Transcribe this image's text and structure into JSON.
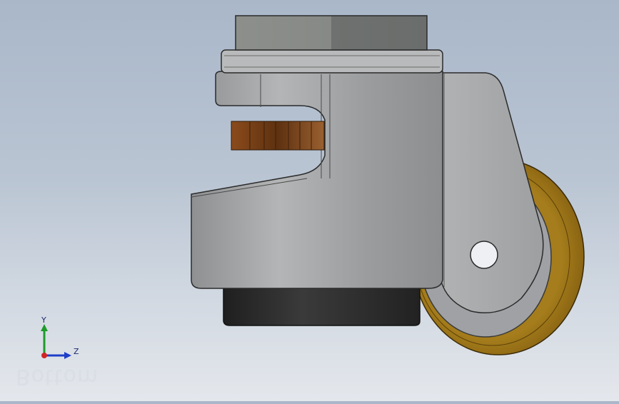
{
  "view": {
    "watermark": "Bottom",
    "triad": {
      "y_label": "Y",
      "z_label": "Z"
    }
  },
  "model": {
    "name": "caster-with-leveling-foot",
    "colors": {
      "body": "#a7a8aa",
      "wheel_tread": "#9b6f17",
      "wheel_hub": "#9ea0a3",
      "brake_pad": "#7a4218",
      "foot_pad": "#2a2a2a",
      "top_plate": "#8a8d8a"
    }
  },
  "icons": [
    "coordinate-triad-icon"
  ]
}
